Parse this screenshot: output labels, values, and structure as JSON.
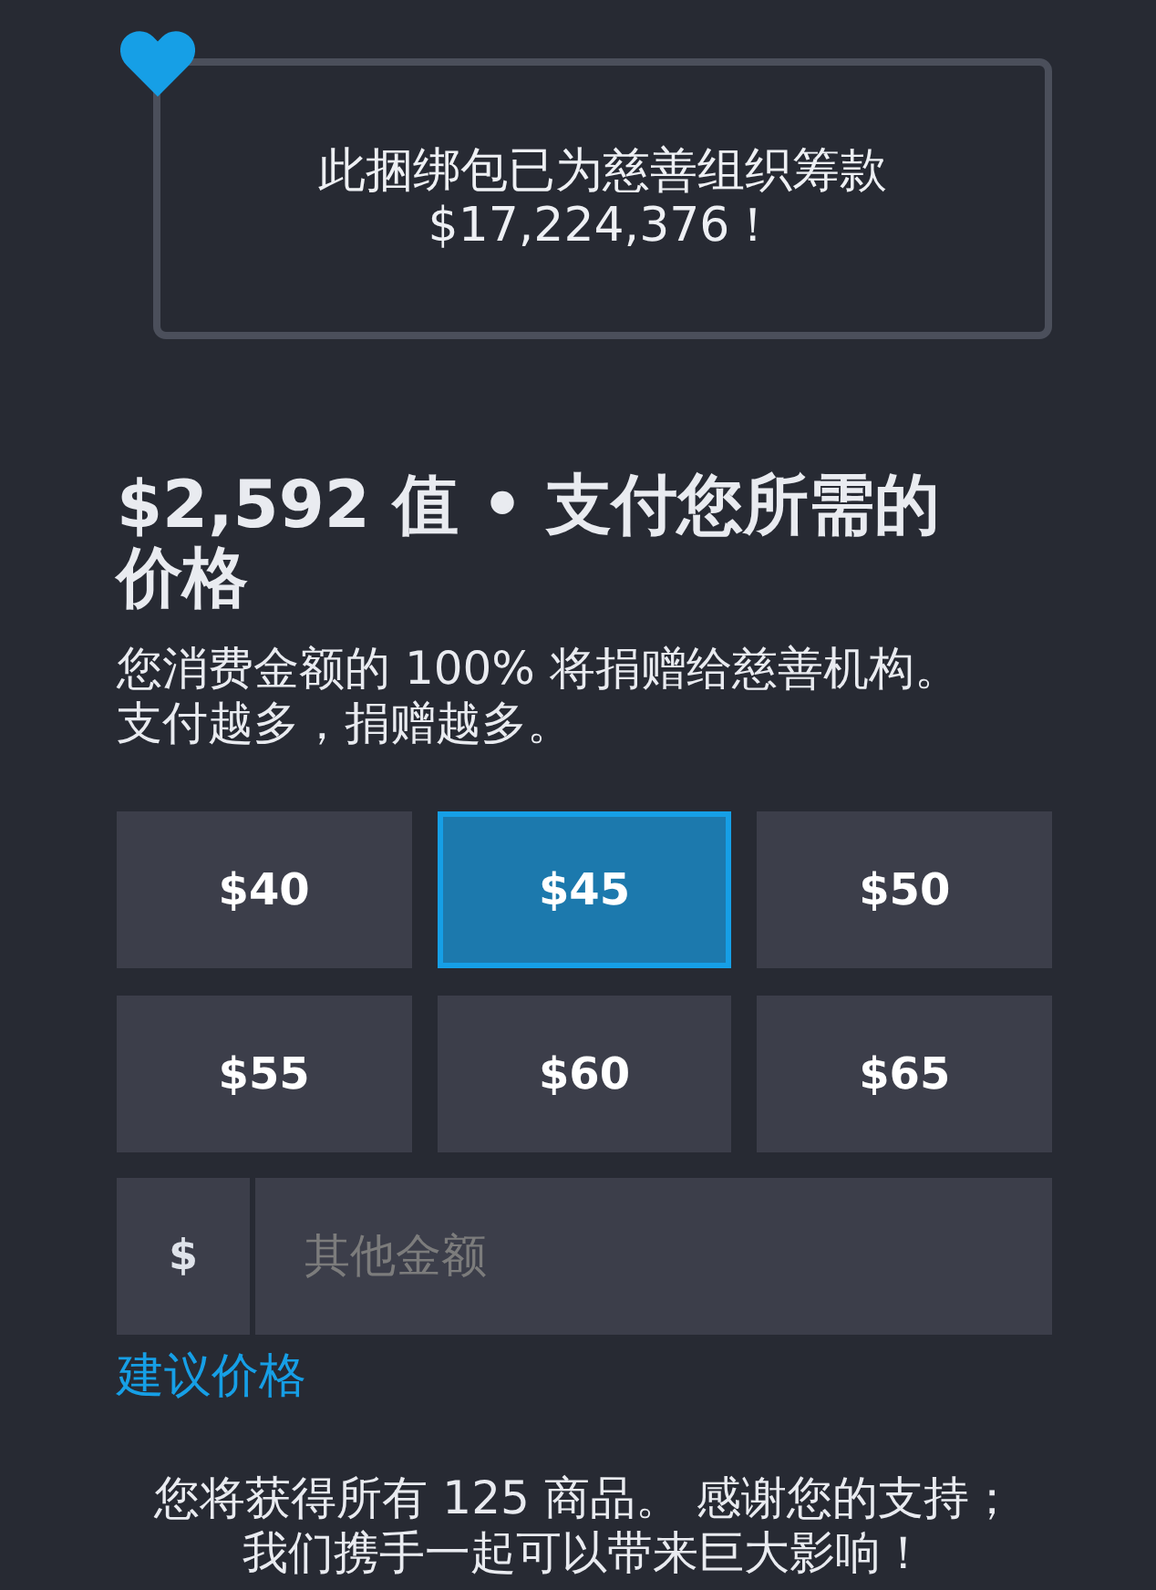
{
  "charity_banner": {
    "text": "此捆绑包已为慈善组织筹款 $17,224,376！"
  },
  "heading": "$2,592 值 • 支付您所需的价格",
  "subheading": "您消费金额的 100% 将捐赠给慈善机构。支付越多，捐赠越多。",
  "price_options": [
    {
      "label": "$40",
      "selected": false
    },
    {
      "label": "$45",
      "selected": true
    },
    {
      "label": "$50",
      "selected": false
    },
    {
      "label": "$55",
      "selected": false
    },
    {
      "label": "$60",
      "selected": false
    },
    {
      "label": "$65",
      "selected": false
    }
  ],
  "custom_amount": {
    "prefix": "$",
    "placeholder": "其他金额"
  },
  "suggested_price_link": "建议价格",
  "footer_text": "您将获得所有 125 商品。 感谢您的支持；我们携手一起可以带来巨大影响！"
}
